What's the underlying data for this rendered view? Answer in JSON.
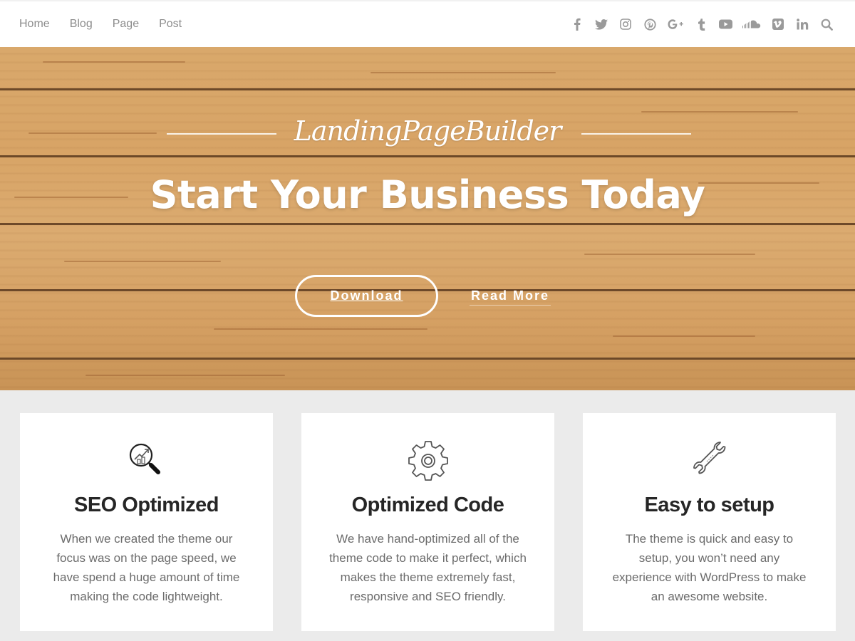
{
  "nav": {
    "items": [
      {
        "label": "Home"
      },
      {
        "label": "Blog"
      },
      {
        "label": "Page"
      },
      {
        "label": "Post"
      }
    ]
  },
  "social": {
    "icons": [
      "facebook-icon",
      "twitter-icon",
      "instagram-icon",
      "pinterest-icon",
      "google-plus-icon",
      "tumblr-icon",
      "youtube-icon",
      "soundcloud-icon",
      "vimeo-icon",
      "linkedin-icon",
      "search-icon"
    ],
    "icon_color": "#9a9a9a"
  },
  "hero": {
    "brand": "LandingPageBuilder",
    "headline": "Start Your Business Today",
    "primary_button": "Download",
    "secondary_button": "Read More"
  },
  "features": [
    {
      "icon": "magnifier-chart-icon",
      "title": "SEO Optimized",
      "text": "When we created the theme our focus was on the page speed, we have spend a huge amount of time making the code lightweight."
    },
    {
      "icon": "gear-icon",
      "title": "Optimized Code",
      "text": "We have hand-optimized all of the theme code to make it perfect, which makes the theme extremely fast, responsive and SEO friendly."
    },
    {
      "icon": "wrench-icon",
      "title": "Easy to setup",
      "text": "The theme is quick and easy to setup, you won’t need any experience with WordPress to make an awesome website."
    }
  ]
}
